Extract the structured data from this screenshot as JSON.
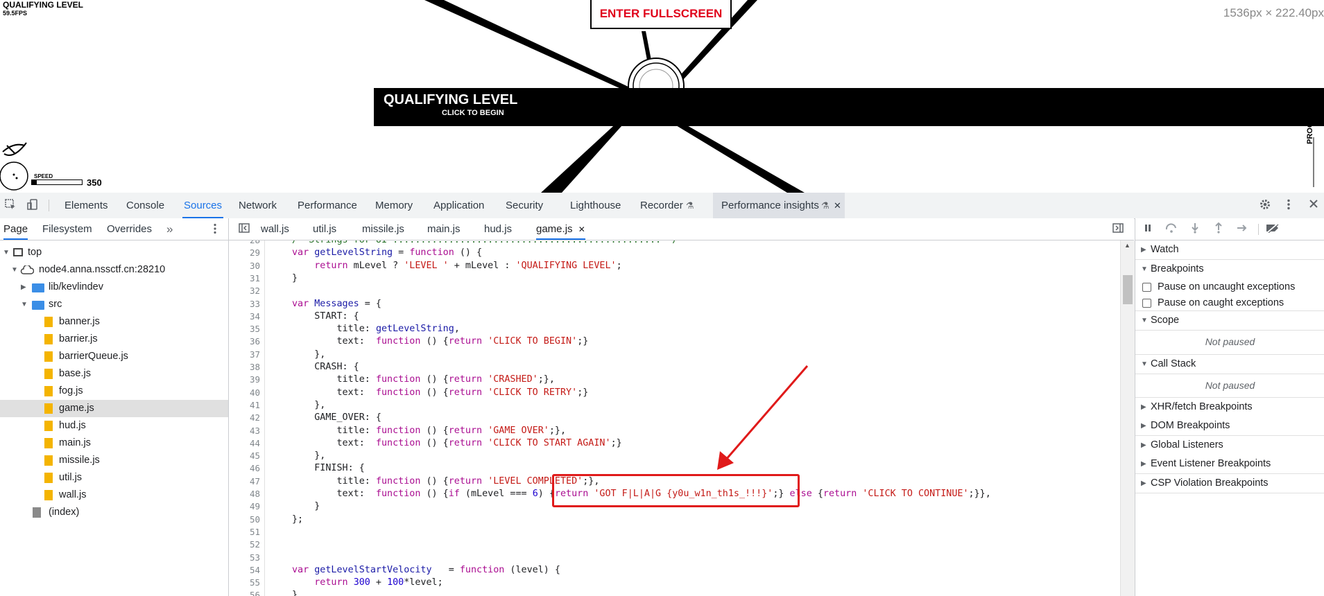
{
  "game": {
    "hud_level": "QUALIFYING LEVEL",
    "fps": "59.5FPS",
    "fullscreen_label": "ENTER FULLSCREEN",
    "viewport_size": "1536px × 222.40px",
    "banner_title": "QUALIFYING LEVEL",
    "banner_subtitle": "CLICK TO BEGIN",
    "speed_label": "SPEED",
    "speed_value": "350",
    "speed_fraction": 0.1,
    "progress_label": "PROGRESS"
  },
  "devtools": {
    "main_tabs": [
      "Elements",
      "Console",
      "Sources",
      "Network",
      "Performance",
      "Memory",
      "Application",
      "Security",
      "Lighthouse",
      "Recorder",
      "Performance insights"
    ],
    "recorder_flask": "⚗",
    "active_tab": "Sources",
    "navigator_tabs": [
      "Page",
      "Filesystem",
      "Overrides"
    ],
    "navigator_more": "»",
    "tree": {
      "top": "top",
      "origin": "node4.anna.nssctf.cn:28210",
      "folder_lib": "lib/kevlindev",
      "folder_src": "src",
      "files": [
        "banner.js",
        "barrier.js",
        "barrierQueue.js",
        "base.js",
        "fog.js",
        "game.js",
        "hud.js",
        "main.js",
        "missile.js",
        "util.js",
        "wall.js"
      ],
      "index": "(index)"
    },
    "editor_tabs": [
      "wall.js",
      "util.js",
      "missile.js",
      "main.js",
      "hud.js",
      "game.js"
    ],
    "active_editor_tab": "game.js",
    "close_glyph": "✕",
    "code_lines": [
      {
        "n": "28",
        "t": "/* Strings for UI ................................................ */"
      },
      {
        "n": "29",
        "t": "var getLevelString = function () {"
      },
      {
        "n": "30",
        "t": "    return mLevel ? 'LEVEL ' + mLevel : 'QUALIFYING LEVEL';"
      },
      {
        "n": "31",
        "t": "}"
      },
      {
        "n": "32",
        "t": ""
      },
      {
        "n": "33",
        "t": "var Messages = {"
      },
      {
        "n": "34",
        "t": "    START: {"
      },
      {
        "n": "35",
        "t": "        title: getLevelString,"
      },
      {
        "n": "36",
        "t": "        text:  function () {return 'CLICK TO BEGIN';}"
      },
      {
        "n": "37",
        "t": "    },"
      },
      {
        "n": "38",
        "t": "    CRASH: {"
      },
      {
        "n": "39",
        "t": "        title: function () {return 'CRASHED';},"
      },
      {
        "n": "40",
        "t": "        text:  function () {return 'CLICK TO RETRY';}"
      },
      {
        "n": "41",
        "t": "    },"
      },
      {
        "n": "42",
        "t": "    GAME_OVER: {"
      },
      {
        "n": "43",
        "t": "        title: function () {return 'GAME OVER';},"
      },
      {
        "n": "44",
        "t": "        text:  function () {return 'CLICK TO START AGAIN';}"
      },
      {
        "n": "45",
        "t": "    },"
      },
      {
        "n": "46",
        "t": "    FINISH: {"
      },
      {
        "n": "47",
        "t": "        title: function () {return 'LEVEL COMPLETED';},"
      },
      {
        "n": "48",
        "t": "        text:  function () {if (mLevel === 6) {return 'GOT F|L|A|G {y0u_w1n_th1s_!!!}';} else {return 'CLICK TO CONTINUE';}},"
      },
      {
        "n": "49",
        "t": "    }"
      },
      {
        "n": "50",
        "t": "};"
      },
      {
        "n": "51",
        "t": ""
      },
      {
        "n": "52",
        "t": ""
      },
      {
        "n": "53",
        "t": ""
      },
      {
        "n": "54",
        "t": "var getLevelStartVelocity   = function (level) {"
      },
      {
        "n": "55",
        "t": "    return 300 + 100*level;"
      },
      {
        "n": "56",
        "t": "}"
      }
    ],
    "debugger": {
      "watch": "Watch",
      "breakpoints": "Breakpoints",
      "pause_uncaught": "Pause on uncaught exceptions",
      "pause_caught": "Pause on caught exceptions",
      "scope": "Scope",
      "scope_status": "Not paused",
      "call_stack": "Call Stack",
      "call_stack_status": "Not paused",
      "xhr": "XHR/fetch Breakpoints",
      "dom": "DOM Breakpoints",
      "global_listeners": "Global Listeners",
      "event_listener": "Event Listener Breakpoints",
      "csp": "CSP Violation Breakpoints"
    }
  },
  "colors": {
    "accent": "#1a73e8",
    "highlight_box": "#e01a1a",
    "fullscreen_text": "#e0001a"
  }
}
